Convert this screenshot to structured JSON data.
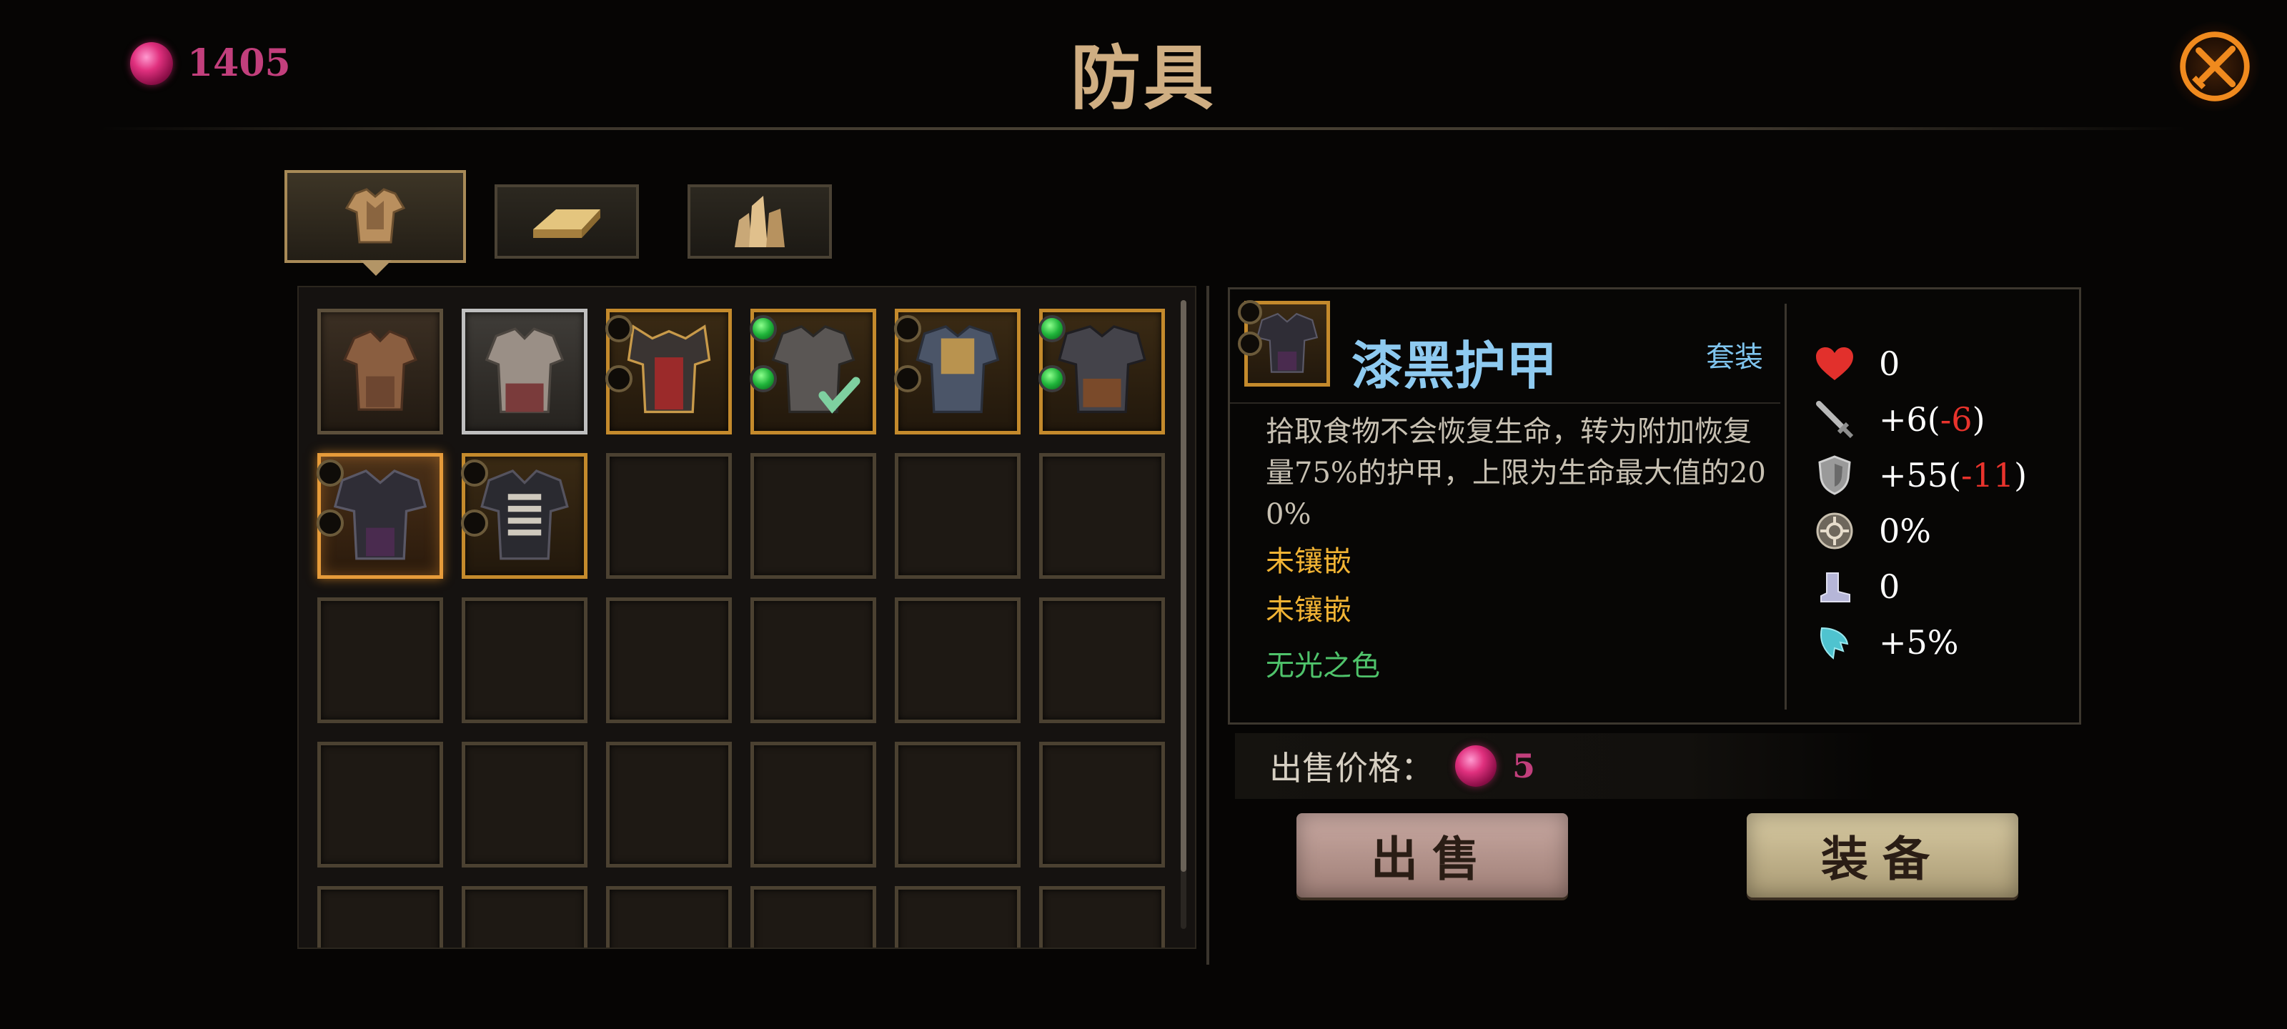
{
  "header": {
    "currency_value": "1405",
    "title": "防具"
  },
  "tabs": [
    {
      "icon": "armor-icon",
      "active": true
    },
    {
      "icon": "ingot-icon",
      "active": false
    },
    {
      "icon": "crystal-icon",
      "active": false
    }
  ],
  "inventory": {
    "filled_items": 8,
    "equipped_item_index": 3
  },
  "detail": {
    "item_name": "漆黑护甲",
    "set_label": "套装",
    "description_lines": [
      "拾取食物不会恢复生命，转为附加恢复",
      "量75%的护甲，上限为生命最大值的20",
      "0%"
    ],
    "socket_1": "未镶嵌",
    "socket_2": "未镶嵌",
    "set_name": "无光之色",
    "stats": {
      "health": "0",
      "attack_base": "+6(",
      "attack_diff": "-6",
      "attack_close": ")",
      "defense_base": "+55(",
      "defense_diff": "-11",
      "defense_close": ")",
      "crit": "0%",
      "speed": "0",
      "special": "+5%"
    }
  },
  "sale": {
    "price_label": "出售价格：",
    "price_value": "5"
  },
  "actions": {
    "sell_label": "出售",
    "equip_label": "装备"
  },
  "colors": {
    "accent_gold": "#c48a2c",
    "currency_pink": "#c23f7c",
    "name_blue": "#8ecaf0",
    "socket_yellow": "#f1b334",
    "set_green": "#4fc36b",
    "negative_red": "#e8332c"
  }
}
